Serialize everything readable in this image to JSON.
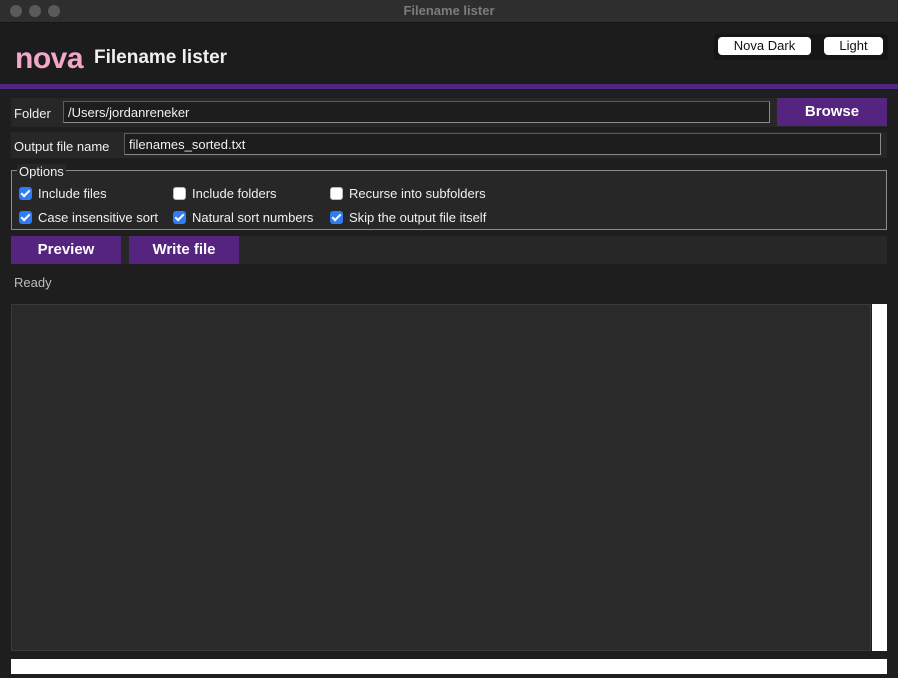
{
  "window": {
    "title": "Filename lister"
  },
  "header": {
    "brand": "nova",
    "title": "Filename lister"
  },
  "theme": {
    "options": [
      "Nova Dark",
      "Light"
    ]
  },
  "folder": {
    "label": "Folder",
    "value": "/Users/jordanreneker",
    "browse_label": "Browse"
  },
  "output": {
    "label": "Output file name",
    "value": "filenames_sorted.txt"
  },
  "options": {
    "legend": "Options",
    "items": [
      {
        "label": "Include files",
        "checked": true
      },
      {
        "label": "Include folders",
        "checked": false
      },
      {
        "label": "Recurse into subfolders",
        "checked": false
      },
      {
        "label": "Case insensitive sort",
        "checked": true
      },
      {
        "label": "Natural sort numbers",
        "checked": true
      },
      {
        "label": "Skip the output file itself",
        "checked": true
      }
    ]
  },
  "actions": {
    "preview_label": "Preview",
    "write_label": "Write file"
  },
  "status": {
    "text": "Ready"
  },
  "colors": {
    "accent": "#54247f",
    "brand": "#f2a7c6",
    "check": "#2f7cf6"
  }
}
